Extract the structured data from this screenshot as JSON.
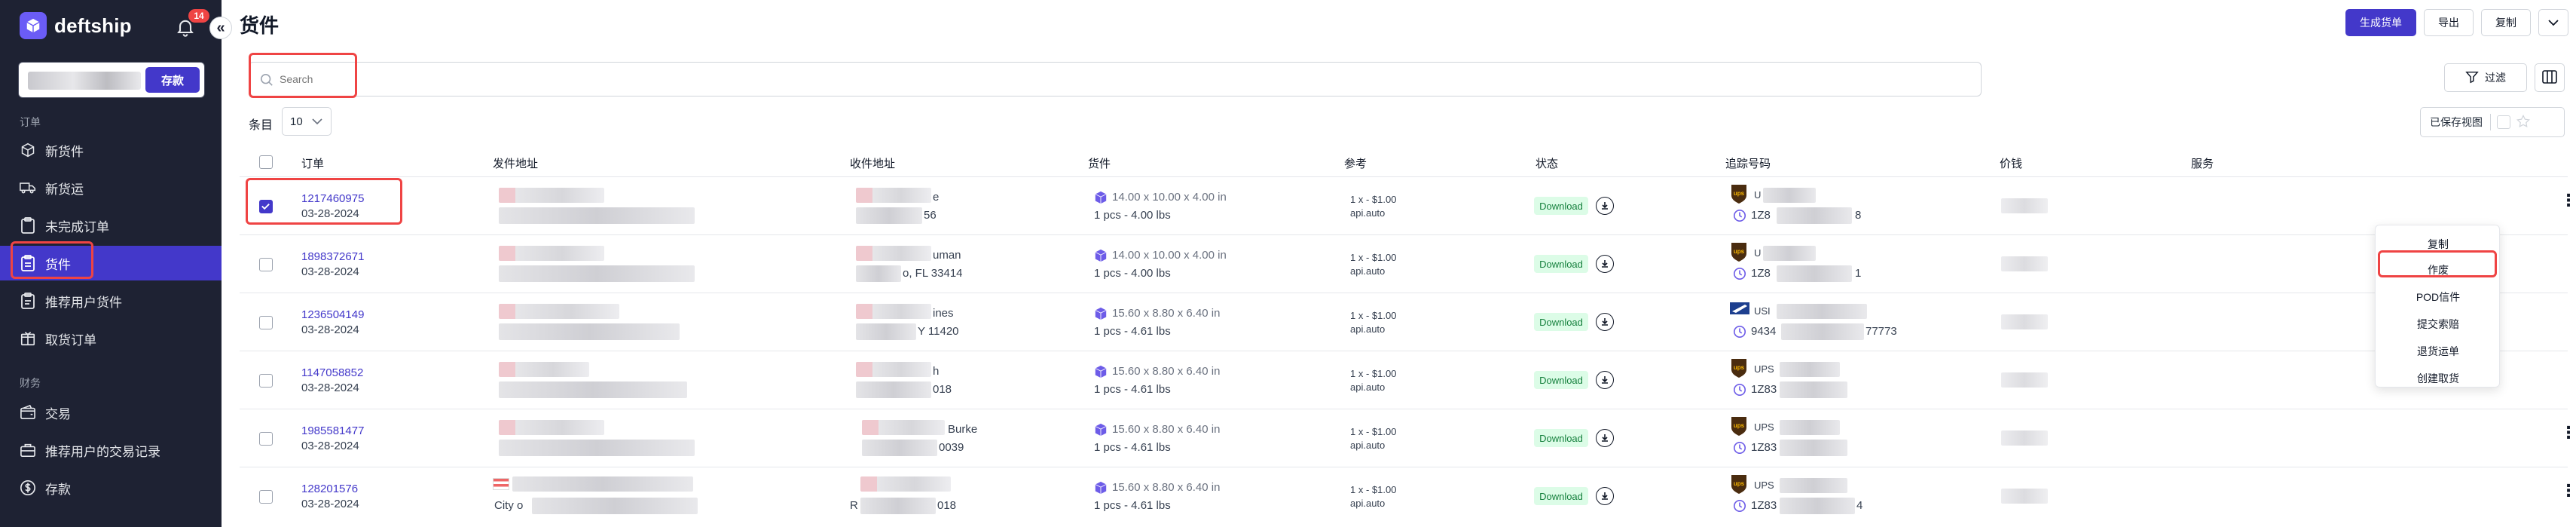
{
  "brand": {
    "name": "deftship"
  },
  "notifications": {
    "count": "14"
  },
  "collapse": {
    "symbol": "«"
  },
  "balance": {
    "deposit_label": "存款"
  },
  "sidebar": {
    "section_orders": "订单",
    "section_finance": "财务",
    "items": [
      {
        "label": "新货件",
        "icon": "cube-icon"
      },
      {
        "label": "新货运",
        "icon": "truck-icon"
      },
      {
        "label": "未完成订单",
        "icon": "clipboard-icon"
      },
      {
        "label": "货件",
        "icon": "clipboard-check-icon",
        "active": true
      },
      {
        "label": "推荐用户货件",
        "icon": "clipboard-user-icon"
      },
      {
        "label": "取货订单",
        "icon": "pickup-icon"
      },
      {
        "label": "交易",
        "icon": "wallet-icon"
      },
      {
        "label": "推荐用户的交易记录",
        "icon": "briefcase-icon"
      },
      {
        "label": "存款",
        "icon": "dollar-circle-icon"
      }
    ]
  },
  "page": {
    "title": "货件"
  },
  "toolbar": {
    "generate_manifest": "生成货单",
    "export": "导出",
    "copy": "复制"
  },
  "search": {
    "placeholder": "Search"
  },
  "filter": {
    "label": "过滤"
  },
  "per_page": {
    "label": "条目",
    "value": "10"
  },
  "saved_views": {
    "label": "已保存视图"
  },
  "table": {
    "headers": [
      "订单",
      "发件地址",
      "收件地址",
      "货件",
      "参考",
      "状态",
      "追踪号码",
      "价钱",
      "服务"
    ],
    "rows": [
      {
        "order": "1217460975",
        "date": "03-28-2024",
        "to_line1": "e",
        "to_line2": "56",
        "dims": "14.00 x 10.00 x 4.00 in",
        "weight": "1 pcs - 4.00 lbs",
        "ref1": "1 x - $1.00",
        "ref2": "api.auto",
        "status": "Download",
        "carrier": "ups",
        "carrier_txt": "U",
        "track_txt": "1Z8",
        "track_tail": "8",
        "checked": true
      },
      {
        "order": "1898372671",
        "date": "03-28-2024",
        "to_line1": "uman",
        "to_line2": "o, FL 33414",
        "dims": "14.00 x 10.00 x 4.00 in",
        "weight": "1 pcs - 4.00 lbs",
        "ref1": "1 x - $1.00",
        "ref2": "api.auto",
        "status": "Download",
        "carrier": "ups",
        "carrier_txt": "U",
        "track_txt": "1Z8",
        "track_tail": "1",
        "checked": false
      },
      {
        "order": "1236504149",
        "date": "03-28-2024",
        "to_line1": "ines",
        "to_line2": "Y 11420",
        "dims": "15.60 x 8.80 x 6.40 in",
        "weight": "1 pcs - 4.61 lbs",
        "ref1": "1 x - $1.00",
        "ref2": "api.auto",
        "status": "Download",
        "carrier": "usps",
        "carrier_txt": "USI",
        "track_txt": "9434",
        "track_tail": "77773",
        "checked": false
      },
      {
        "order": "1147058852",
        "date": "03-28-2024",
        "to_line1": "h",
        "to_line2": "018",
        "dims": "15.60 x 8.80 x 6.40 in",
        "weight": "1 pcs - 4.61 lbs",
        "ref1": "1 x - $1.00",
        "ref2": "api.auto",
        "status": "Download",
        "carrier": "ups",
        "carrier_txt": "UPS",
        "track_txt": "1Z83",
        "track_tail": "",
        "checked": false
      },
      {
        "order": "1985581477",
        "date": "03-28-2024",
        "to_line1": "Burke",
        "to_line2": "0039",
        "dims": "15.60 x 8.80 x 6.40 in",
        "weight": "1 pcs - 4.61 lbs",
        "ref1": "1 x - $1.00",
        "ref2": "api.auto",
        "status": "Download",
        "carrier": "ups",
        "carrier_txt": "UPS",
        "track_txt": "1Z83",
        "track_tail": "",
        "checked": false
      },
      {
        "order": "128201576",
        "date": "03-28-2024",
        "to_line1": "",
        "to_line2": "018",
        "dims": "15.60 x 8.80 x 6.40 in",
        "weight": "1 pcs - 4.61 lbs",
        "ref1": "1 x - $1.00",
        "ref2": "api.auto",
        "status": "Download",
        "carrier": "ups",
        "carrier_txt": "UPS",
        "track_txt": "1Z83",
        "track_tail": "4",
        "checked": false,
        "from_city": "City o",
        "to_prefix": "R"
      }
    ]
  },
  "row_menu": {
    "items": [
      "复制",
      "作废",
      "POD信件",
      "提交索赔",
      "退货运单",
      "创建取货"
    ]
  },
  "colors": {
    "accent": "#4338ca",
    "sidebar_bg": "#1e2233",
    "annotation": "#ef4444",
    "status_bg": "#dcfce7"
  }
}
